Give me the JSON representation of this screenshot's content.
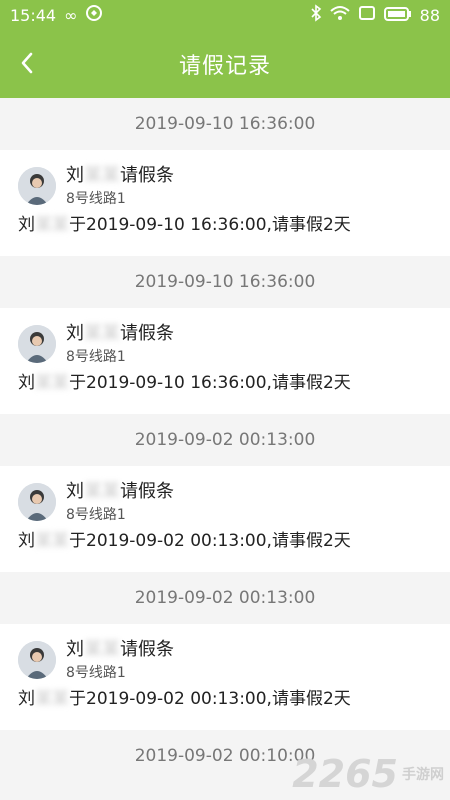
{
  "status_bar": {
    "time": "15:44",
    "battery": "88"
  },
  "app_bar": {
    "title": "请假记录"
  },
  "records": [
    {
      "date": "2019-09-10 16:36:00",
      "name_prefix": "刘",
      "name_hidden": "某某",
      "name_suffix": "请假条",
      "route": "8号线路1",
      "msg_prefix": "刘",
      "msg_hidden": "某某",
      "msg_text": "于2019-09-10 16:36:00,请事假2天"
    },
    {
      "date": "2019-09-10 16:36:00",
      "name_prefix": "刘",
      "name_hidden": "某某",
      "name_suffix": "请假条",
      "route": "8号线路1",
      "msg_prefix": "刘",
      "msg_hidden": "某某",
      "msg_text": "于2019-09-10 16:36:00,请事假2天"
    },
    {
      "date": "2019-09-02 00:13:00",
      "name_prefix": "刘",
      "name_hidden": "某某",
      "name_suffix": "请假条",
      "route": "8号线路1",
      "msg_prefix": "刘",
      "msg_hidden": "某某",
      "msg_text": "于2019-09-02 00:13:00,请事假2天"
    },
    {
      "date": "2019-09-02 00:13:00",
      "name_prefix": "刘",
      "name_hidden": "某某",
      "name_suffix": "请假条",
      "route": "8号线路1",
      "msg_prefix": "刘",
      "msg_hidden": "某某",
      "msg_text": "于2019-09-02 00:13:00,请事假2天"
    }
  ],
  "last_date": "2019-09-02 00:10:00",
  "watermark": {
    "number": "2265",
    "site": "手游网"
  },
  "colors": {
    "accent": "#8bc34a"
  }
}
